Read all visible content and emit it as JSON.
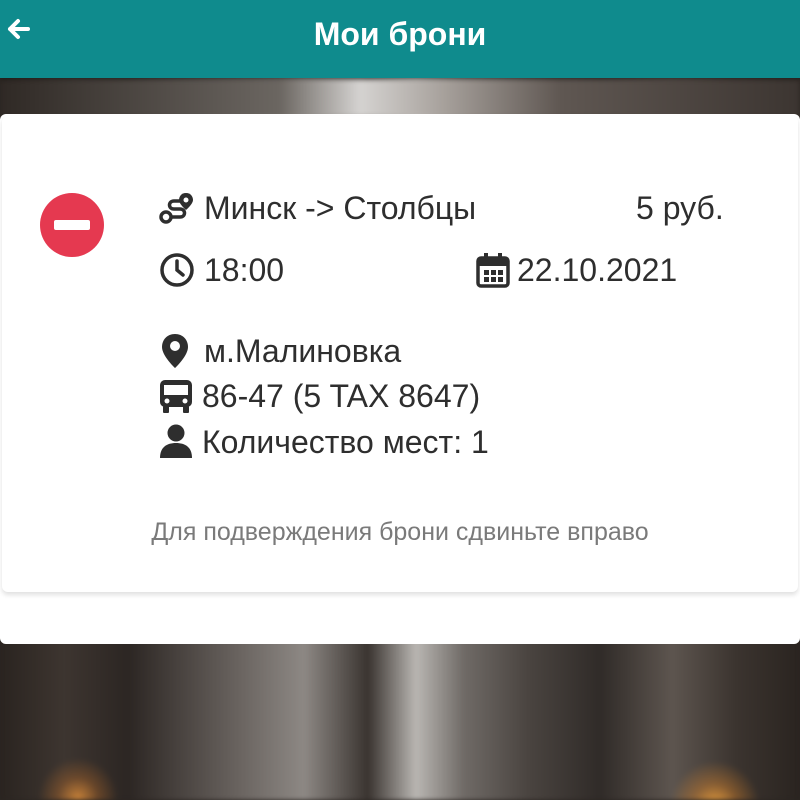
{
  "header": {
    "title": "Мои брони",
    "back_icon": "arrow-left-icon",
    "background_color": "#0f8b8d"
  },
  "booking": {
    "cancel_icon": "minus-circle-icon",
    "cancel_color": "#e53950",
    "route": "Минск -> Столбцы",
    "price": "5 руб.",
    "time": "18:00",
    "date": "22.10.2021",
    "pickup_point": "м.Малиновка",
    "vehicle": "86-47 (5 TAX 8647)",
    "seats": "Количество мест: 1",
    "icons": {
      "route": "route-icon",
      "time": "clock-icon",
      "date": "calendar-icon",
      "pickup": "map-pin-icon",
      "vehicle": "bus-icon",
      "seats": "user-icon"
    }
  },
  "hint": "Для подверждения брони сдвиньте вправо"
}
